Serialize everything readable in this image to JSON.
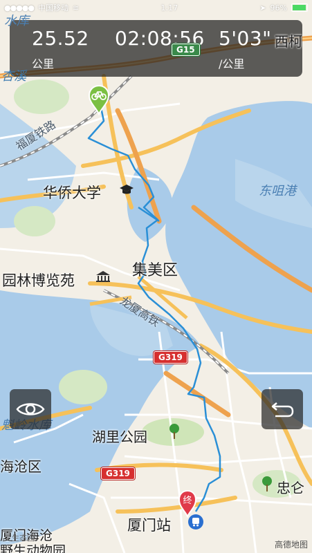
{
  "status_bar": {
    "carrier": "中国移动",
    "time": "1:17",
    "battery": "96%"
  },
  "stats": {
    "distance": {
      "value": "25.52",
      "unit": "公里"
    },
    "duration": {
      "value": "02:08:56",
      "unit": ""
    },
    "pace": {
      "value": "5'03\"",
      "unit": "/公里"
    }
  },
  "labels": {
    "shuiku_top": "水库",
    "xike": "西柯",
    "xingxi": "杏溪",
    "fuxia_railway": "福厦铁路",
    "huaqiao_univ": "华侨大学",
    "dongju_port": "东咀港",
    "jimei_district": "集美区",
    "garden_expo": "园林博览苑",
    "longxia_highway": "龙厦高铁",
    "xinling_reservoir": "魁岭水库",
    "hucang_district": "海沧区",
    "huli_park": "湖里公园",
    "zhong_name": "忠仑",
    "xiamen_station": "厦门站",
    "haicang_wildlife": "厦门海沧",
    "wildlife_line2": "野生动物园",
    "attribution_left": "生态园",
    "attribution_right": "高德地图"
  },
  "route_markers": {
    "start_icon": "bicycle-icon",
    "end_text": "终"
  },
  "highways": [
    {
      "code": "G15"
    },
    {
      "code": "G319"
    },
    {
      "code": "G319"
    }
  ],
  "buttons": {
    "view": {
      "icon": "eye-icon"
    },
    "back": {
      "icon": "undo-icon"
    }
  },
  "colors": {
    "route": "#2a8fd6",
    "water": "#a9cbe9",
    "land": "#f3efe6",
    "highway_red": "#d62f2f",
    "major_road": "#f6c15a"
  }
}
